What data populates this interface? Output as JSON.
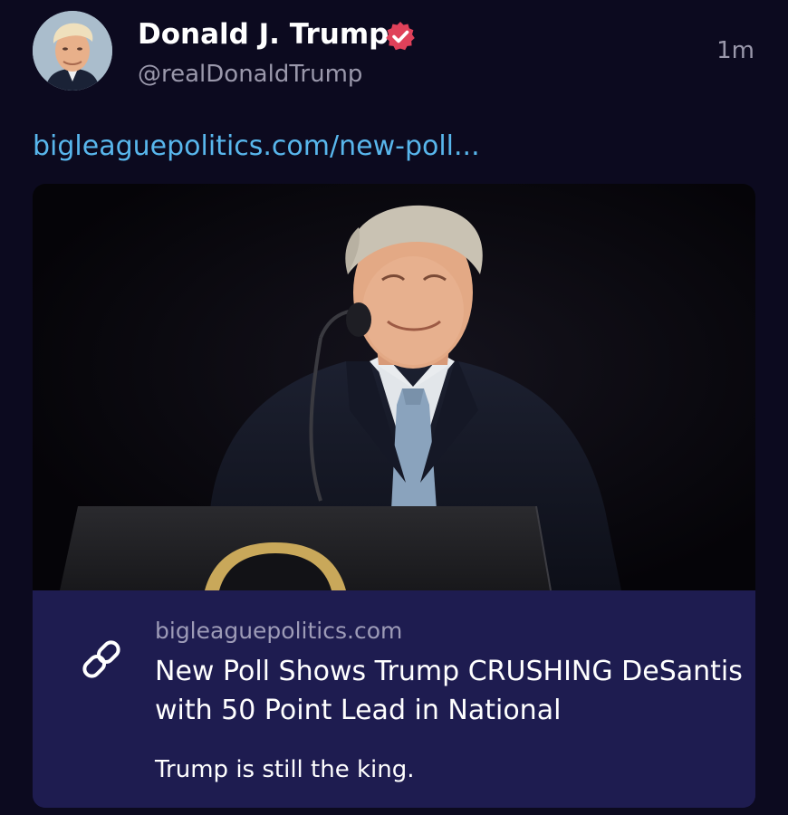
{
  "post": {
    "author": {
      "display_name": "Donald J. Trump",
      "handle": "@realDonaldTrump",
      "verified": true,
      "avatar_icon": "avatar-photo"
    },
    "timestamp": "1m",
    "link_text": "bigleaguepolitics.com/new-poll...",
    "link_card": {
      "image_icon": "article-photo",
      "icon": "link-icon",
      "domain": "bigleaguepolitics.com",
      "title": "New Poll Shows Trump CRUSHING DeSantis with 50 Point Lead in National",
      "description": "Trump is still the king."
    }
  },
  "colors": {
    "background": "#0c0a1f",
    "link": "#58b6ec",
    "card_background": "#1e1c50",
    "muted_text": "#9a98ab",
    "verified_badge": "#e0415a"
  }
}
